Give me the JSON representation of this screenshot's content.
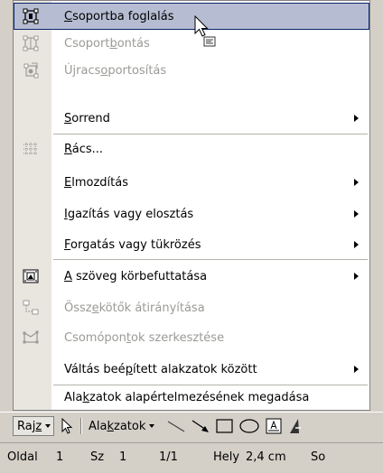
{
  "menu": {
    "items": [
      {
        "id": "group",
        "label_pre": "",
        "label_u": "C",
        "label_post": "soportba foglalás",
        "icon": "group-icon",
        "disabled": false,
        "submenu": false,
        "highlighted": true
      },
      {
        "id": "ungroup",
        "label_pre": "Csoport",
        "label_u": "b",
        "label_post": "ontás",
        "icon": "ungroup-icon",
        "disabled": true,
        "submenu": false,
        "highlighted": false
      },
      {
        "id": "regroup",
        "label_pre": "Újracs",
        "label_u": "o",
        "label_post": "portosítás",
        "icon": "regroup-icon",
        "disabled": true,
        "submenu": false,
        "highlighted": false
      },
      {
        "id": "order",
        "label_pre": "",
        "label_u": "S",
        "label_post": "orrend",
        "icon": "",
        "disabled": false,
        "submenu": true,
        "highlighted": false
      },
      {
        "id": "grid",
        "label_pre": "",
        "label_u": "R",
        "label_post": "ács...",
        "icon": "grid-icon",
        "disabled": false,
        "submenu": false,
        "highlighted": false
      },
      {
        "id": "nudge",
        "label_pre": "",
        "label_u": "E",
        "label_post": "lmozdítás",
        "icon": "",
        "disabled": false,
        "submenu": true,
        "highlighted": false
      },
      {
        "id": "align",
        "label_pre": "",
        "label_u": "I",
        "label_post": "gazítás vagy elosztás",
        "icon": "",
        "disabled": false,
        "submenu": true,
        "highlighted": false
      },
      {
        "id": "rotate",
        "label_pre": "",
        "label_u": "F",
        "label_post": "orgatás vagy tükrözés",
        "icon": "",
        "disabled": false,
        "submenu": true,
        "highlighted": false
      },
      {
        "id": "wrap",
        "label_pre": "",
        "label_u": "A",
        "label_post": " szöveg körbefuttatása",
        "icon": "text-wrap-icon",
        "disabled": false,
        "submenu": true,
        "highlighted": false
      },
      {
        "id": "reroute",
        "label_pre": "Össz",
        "label_u": "e",
        "label_post": "kötők átirányítása",
        "icon": "reroute-connectors-icon",
        "disabled": true,
        "submenu": false,
        "highlighted": false
      },
      {
        "id": "editpoints",
        "label_pre": "Csomópon",
        "label_u": "t",
        "label_post": "ok szerkesztése",
        "icon": "edit-points-icon",
        "disabled": true,
        "submenu": false,
        "highlighted": false
      },
      {
        "id": "switch",
        "label_pre": "Váltás beé",
        "label_u": "p",
        "label_post": "ített alakzatok között",
        "icon": "",
        "disabled": false,
        "submenu": true,
        "highlighted": false
      },
      {
        "id": "defaults",
        "label_pre": "Ala",
        "label_u": "k",
        "label_post": "zatok alapértelmezésének megadása",
        "icon": "",
        "disabled": false,
        "submenu": false,
        "highlighted": false
      }
    ]
  },
  "toolbar": {
    "rajz_pre": "Raj",
    "rajz_u": "z",
    "autoshapes_pre": "Ala",
    "autoshapes_u": "k",
    "autoshapes_post": "zatok"
  },
  "status": {
    "page_label": "Oldal",
    "page_value": "1",
    "section_label": "Sz",
    "section_value": "1",
    "page_of": "1/1",
    "position_label": "Hely",
    "position_value": "2,4 cm",
    "truncated": "So"
  }
}
